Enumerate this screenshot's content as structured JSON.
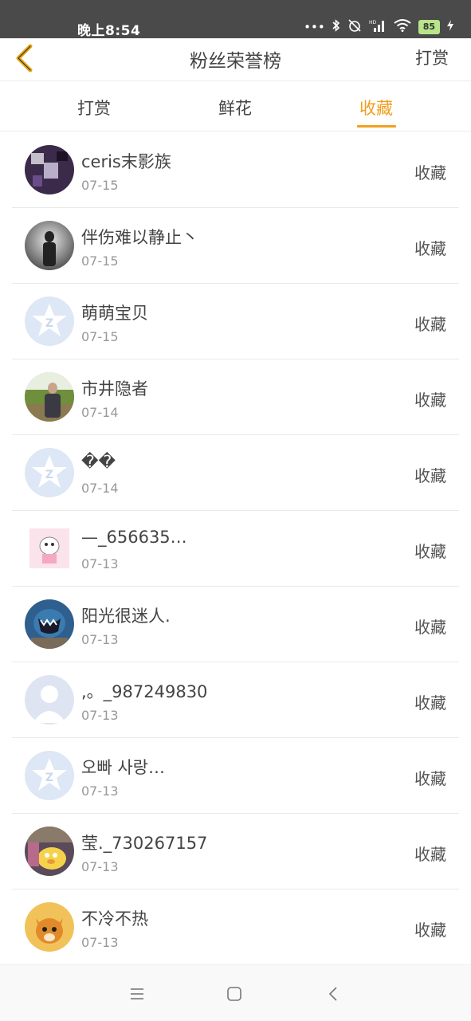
{
  "status_bar": {
    "time": "晚上8:54",
    "battery": "85",
    "icons": [
      "more-dots-icon",
      "bluetooth-icon",
      "alarm-off-icon",
      "hd-signal-icon",
      "wifi-icon",
      "battery-icon",
      "charging-icon"
    ]
  },
  "header": {
    "title": "粉丝荣誉榜",
    "action_label": "打赏"
  },
  "tabs": [
    {
      "label": "打赏"
    },
    {
      "label": "鲜花"
    },
    {
      "label": "收藏"
    }
  ],
  "active_tab": 2,
  "accent_color": "#f0a020",
  "list": [
    {
      "name": "ceris末影族",
      "date": "07-15",
      "action": "收藏"
    },
    {
      "name": "伴伤难以静止丶",
      "date": "07-15",
      "action": "收藏"
    },
    {
      "name": "萌萌宝贝",
      "date": "07-15",
      "action": "收藏"
    },
    {
      "name": "市井隐者",
      "date": "07-14",
      "action": "收藏"
    },
    {
      "name": "��",
      "date": "07-14",
      "action": "收藏"
    },
    {
      "name": "—_656635…",
      "date": "07-13",
      "action": "收藏"
    },
    {
      "name": "阳光很迷人.",
      "date": "07-13",
      "action": "收藏"
    },
    {
      "name": ",。_987249830",
      "date": "07-13",
      "action": "收藏"
    },
    {
      "name": "오빠 사랑…",
      "date": "07-13",
      "action": "收藏"
    },
    {
      "name": "莹._730267157",
      "date": "07-13",
      "action": "收藏"
    },
    {
      "name": "不冷不热",
      "date": "07-13",
      "action": "收藏"
    }
  ],
  "system_nav": [
    "menu-icon",
    "home-icon",
    "back-icon"
  ]
}
